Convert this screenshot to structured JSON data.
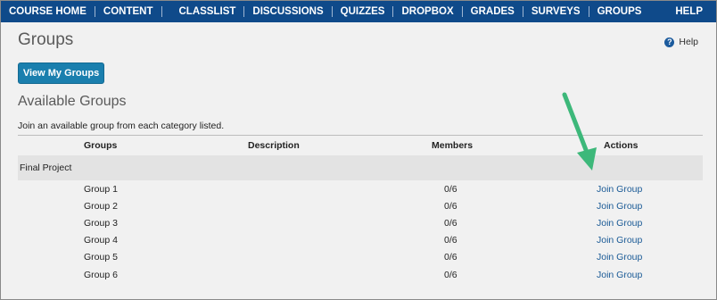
{
  "nav": {
    "items": [
      "COURSE HOME",
      "CONTENT",
      "CLASSLIST",
      "DISCUSSIONS",
      "QUIZZES",
      "DROPBOX",
      "GRADES",
      "SURVEYS",
      "GROUPS"
    ],
    "help": "HELP"
  },
  "page": {
    "title": "Groups",
    "help_label": "Help",
    "button_label": "View My Groups"
  },
  "section": {
    "title": "Available Groups",
    "description": "Join an available group from each category listed."
  },
  "table": {
    "headers": {
      "groups": "Groups",
      "description": "Description",
      "members": "Members",
      "actions": "Actions"
    },
    "category": "Final Project",
    "rows": [
      {
        "name": "Group 1",
        "members": "0/6",
        "action": "Join Group"
      },
      {
        "name": "Group 2",
        "members": "0/6",
        "action": "Join Group"
      },
      {
        "name": "Group 3",
        "members": "0/6",
        "action": "Join Group"
      },
      {
        "name": "Group 4",
        "members": "0/6",
        "action": "Join Group"
      },
      {
        "name": "Group 5",
        "members": "0/6",
        "action": "Join Group"
      },
      {
        "name": "Group 6",
        "members": "0/6",
        "action": "Join Group"
      }
    ]
  },
  "colors": {
    "nav_bg": "#0f4a8a",
    "button": "#1a7fae",
    "link": "#1a5a96",
    "arrow": "#3db87a"
  },
  "icons": {
    "help": "question-circle-icon",
    "annotation": "green-arrow-icon"
  }
}
